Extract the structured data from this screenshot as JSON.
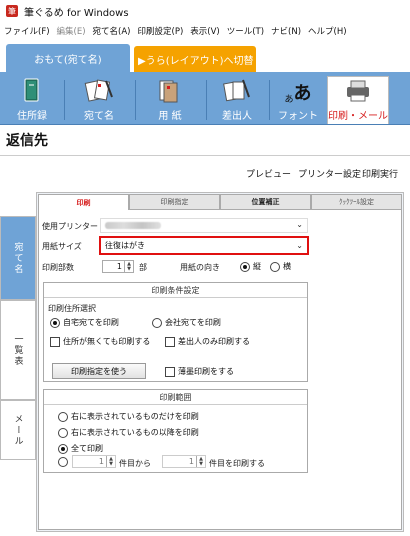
{
  "window": {
    "title": "筆ぐるめ for Windows",
    "icon": "app-logo-icon"
  },
  "menu": [
    {
      "label": "ファイル(F)",
      "disabled": false
    },
    {
      "label": "編集(E)",
      "disabled": true
    },
    {
      "label": "宛て名(A)",
      "disabled": false
    },
    {
      "label": "印刷設定(P)",
      "disabled": false
    },
    {
      "label": "表示(V)",
      "disabled": false
    },
    {
      "label": "ツール(T)",
      "disabled": false
    },
    {
      "label": "ナビ(N)",
      "disabled": false
    },
    {
      "label": "ヘルプ(H)",
      "disabled": false
    }
  ],
  "mode_tabs": {
    "front": "おもて(宛て名)",
    "back": "▶うら(レイアウト)へ切替"
  },
  "toolbar": [
    {
      "label": "住所録",
      "icon": "address-book-icon"
    },
    {
      "label": "宛て名",
      "icon": "address-cards-icon"
    },
    {
      "label": "用 紙",
      "icon": "paper-icon"
    },
    {
      "label": "差出人",
      "icon": "sender-icon"
    },
    {
      "label": "フォント",
      "icon": "font-icon",
      "glyph": "あ"
    },
    {
      "label": "印刷・メール",
      "icon": "printer-icon"
    }
  ],
  "page_title": "返信先",
  "actions": {
    "preview": "プレビュー",
    "printer_settings": "プリンター設定",
    "print": "印刷実行"
  },
  "side_tabs": [
    "宛て名",
    "一覧表",
    "メール"
  ],
  "inner_tabs": [
    "印刷",
    "印刷指定",
    "位置補正",
    "ｸｯｸﾂｰﾙ設定"
  ],
  "form": {
    "printer_label": "使用プリンター",
    "paper_size_label": "用紙サイズ",
    "paper_size_value": "往復はがき",
    "copies_label": "印刷部数",
    "copies_value": "1",
    "copies_unit": "部",
    "orientation_label": "用紙の向き",
    "orientation_options": [
      "縦",
      "横"
    ]
  },
  "conditions": {
    "title": "印刷条件設定",
    "address_select_label": "印刷住所選択",
    "address_options": [
      "自宅宛てを印刷",
      "会社宛てを印刷"
    ],
    "checkboxes": [
      "住所が無くても印刷する",
      "差出人のみ印刷する",
      "薄墨印刷をする"
    ],
    "use_spec_button": "印刷指定を使う"
  },
  "range": {
    "title": "印刷範囲",
    "options": [
      "右に表示されているものだけを印刷",
      "右に表示されているもの以降を印刷",
      "全て印刷"
    ],
    "from_value": "1",
    "from_suffix": "件目から",
    "to_value": "1",
    "to_suffix": "件目を印刷する"
  },
  "colors": {
    "accent_blue": "#6fa3d6",
    "orange": "#f5a200",
    "red": "#e01010"
  }
}
